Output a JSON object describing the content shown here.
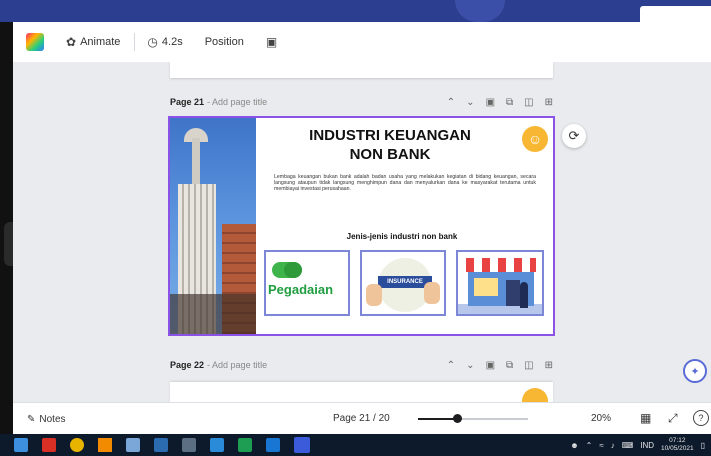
{
  "toolbar": {
    "animate_label": "Animate",
    "timer_label": "4.2s",
    "position_label": "Position"
  },
  "pages": {
    "current": {
      "name": "Page 21",
      "subtitle": "- Add page title"
    },
    "next": {
      "name": "Page 22",
      "subtitle": "- Add page title"
    }
  },
  "slide": {
    "title_line1": "INDUSTRI KEUANGAN",
    "title_line2": "NON BANK",
    "body": "Lembaga keuangan bukan bank adalah badan usaha yang melakukan kegiatan di bidang keuangan, secara langsung ataupun tidak langsung menghimpun dana dan menyalurkan dana ke masyarakat terutama untuk membiayai investasi perusahaan.",
    "subheading": "Jenis-jenis industri non bank",
    "cards": [
      {
        "label": "Pegadaian"
      },
      {
        "label": "INSURANCE"
      },
      {
        "label": ""
      }
    ]
  },
  "bottom": {
    "notes_label": "Notes",
    "page_indicator": "Page 21 / 20",
    "zoom_label": "20%",
    "zoom_value": 0.35
  },
  "taskbar": {
    "time": "07:12",
    "date": "10/05/2021",
    "lang": "IND"
  },
  "colors": {
    "slide_border": "#8a52e6",
    "accent_badge": "#f7b733",
    "taskbar_bg": "#0c1a2c"
  }
}
